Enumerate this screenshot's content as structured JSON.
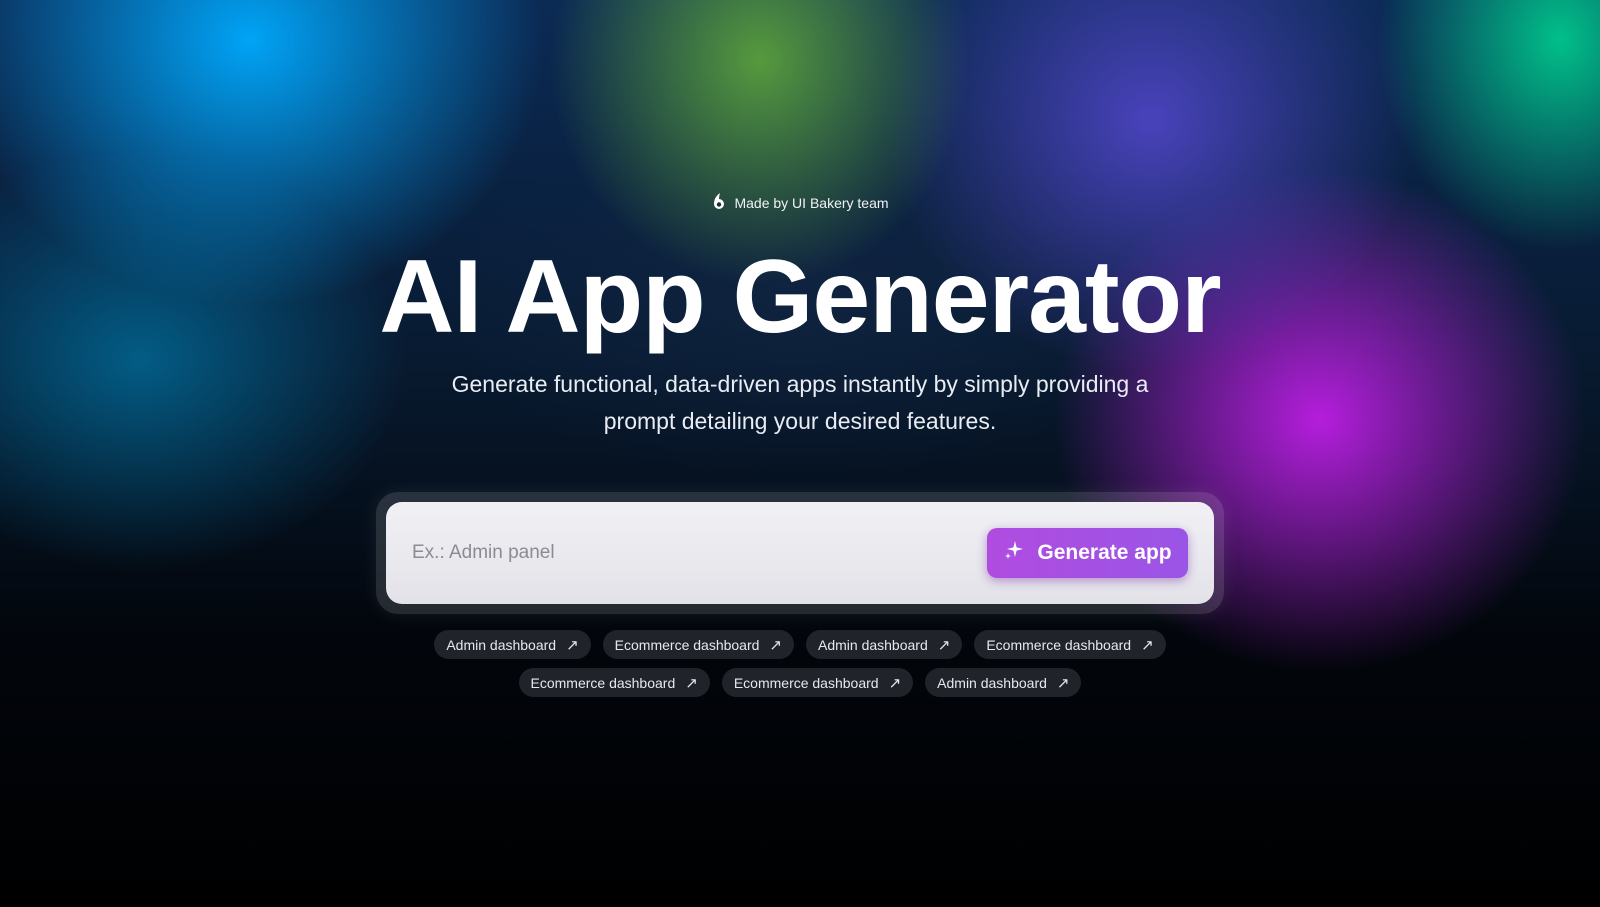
{
  "badge": {
    "icon": "ui-bakery-logo-icon",
    "text": "Made by UI Bakery team"
  },
  "hero": {
    "title": "AI App Generator",
    "subtitle_line1": "Generate functional, data-driven apps instantly by simply providing a",
    "subtitle_line2": "prompt detailing your desired features."
  },
  "prompt": {
    "placeholder": "Ex.: Admin panel",
    "value": "",
    "button_label": "Generate app",
    "button_icon": "sparkle-icon"
  },
  "suggestions": {
    "arrow_icon": "arrow-up-right-icon",
    "row1": [
      "Admin dashboard",
      "Ecommerce dashboard",
      "Admin dashboard",
      "Ecommerce dashboard"
    ],
    "row2": [
      "Ecommerce dashboard",
      "Ecommerce dashboard",
      "Admin dashboard"
    ]
  },
  "colors": {
    "accent": "#a64fe3",
    "input_bg": "#ebeaf0"
  }
}
